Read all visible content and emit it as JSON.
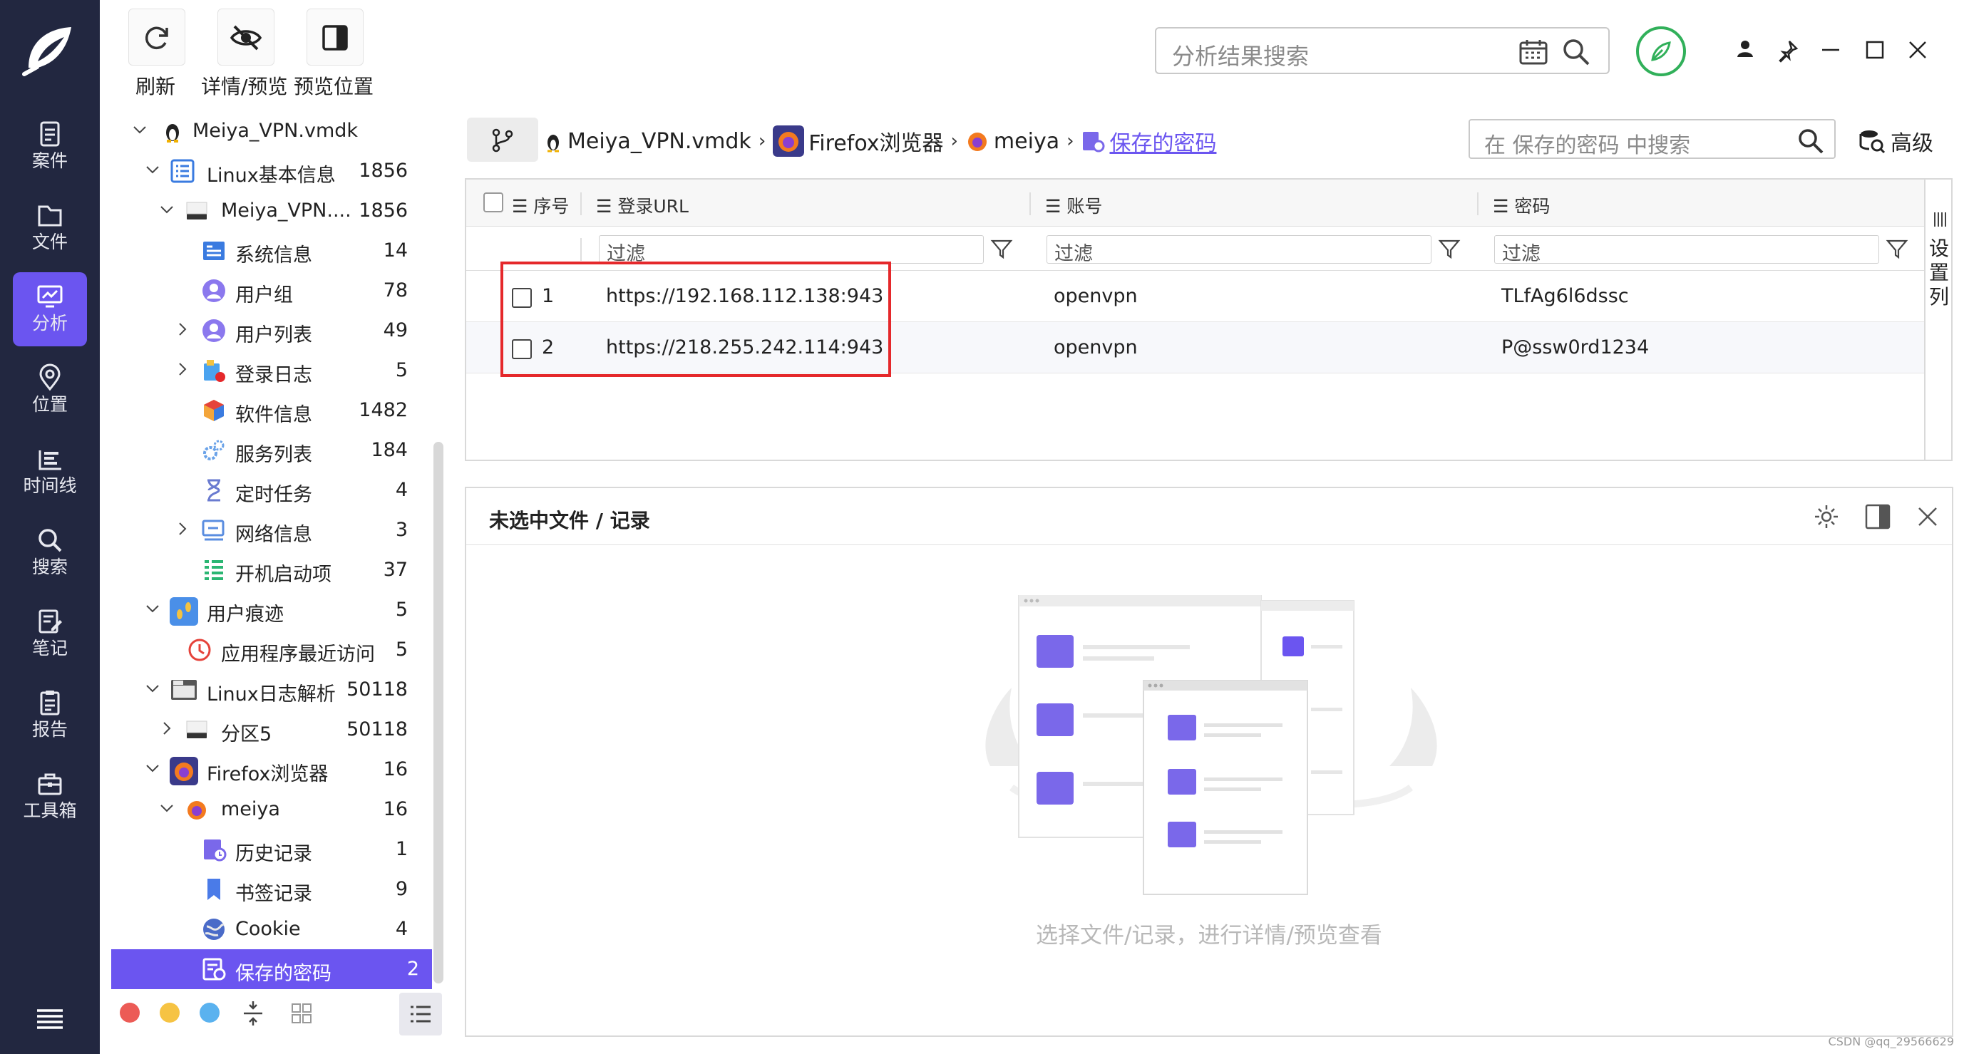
{
  "toolbar": {
    "refresh_label": "刷新",
    "detail_label": "详情/预览",
    "preview_pos_label": "预览位置",
    "search_placeholder": "分析结果搜索"
  },
  "rail": {
    "items": [
      {
        "label": "案件"
      },
      {
        "label": "文件"
      },
      {
        "label": "分析"
      },
      {
        "label": "位置"
      },
      {
        "label": "时间线"
      },
      {
        "label": "搜索"
      },
      {
        "label": "笔记"
      },
      {
        "label": "报告"
      },
      {
        "label": "工具箱"
      }
    ],
    "active_index": 2
  },
  "tree": {
    "items": [
      {
        "label": "Meiya_VPN.vmdk",
        "count": ""
      },
      {
        "label": "Linux基本信息",
        "count": "1856"
      },
      {
        "label": "Meiya_VPN....",
        "count": "1856"
      },
      {
        "label": "系统信息",
        "count": "14"
      },
      {
        "label": "用户组",
        "count": "78"
      },
      {
        "label": "用户列表",
        "count": "49"
      },
      {
        "label": "登录日志",
        "count": "5"
      },
      {
        "label": "软件信息",
        "count": "1482"
      },
      {
        "label": "服务列表",
        "count": "184"
      },
      {
        "label": "定时任务",
        "count": "4"
      },
      {
        "label": "网络信息",
        "count": "3"
      },
      {
        "label": "开机启动项",
        "count": "37"
      },
      {
        "label": "用户痕迹",
        "count": "5"
      },
      {
        "label": "应用程序最近访问",
        "count": "5"
      },
      {
        "label": "Linux日志解析",
        "count": "50118"
      },
      {
        "label": "分区5",
        "count": "50118"
      },
      {
        "label": "Firefox浏览器",
        "count": "16"
      },
      {
        "label": "meiya",
        "count": "16"
      },
      {
        "label": "历史记录",
        "count": "1"
      },
      {
        "label": "书签记录",
        "count": "9"
      },
      {
        "label": "Cookie",
        "count": "4"
      },
      {
        "label": "保存的密码",
        "count": "2"
      }
    ]
  },
  "breadcrumb": {
    "items": [
      "Meiya_VPN.vmdk",
      "Firefox浏览器",
      "meiya",
      "保存的密码"
    ],
    "search_placeholder": "在 保存的密码 中搜索",
    "advanced_label": "高级"
  },
  "grid": {
    "columns": [
      "序号",
      "登录URL",
      "账号",
      "密码"
    ],
    "filter_placeholder": "过滤",
    "rows": [
      {
        "index": "1",
        "url": "https://192.168.112.138:943",
        "account": "openvpn",
        "password": "TLfAg6l6dssc"
      },
      {
        "index": "2",
        "url": "https://218.255.242.114:943",
        "account": "openvpn",
        "password": "P@ssw0rd1234"
      }
    ],
    "set_columns_label": "设置列"
  },
  "detail": {
    "title": "未选中文件 / 记录",
    "empty_message": "选择文件/记录，进行详情/预览查看"
  },
  "watermark": "CSDN @qq_29566629",
  "colors": {
    "accent": "#6b55f0",
    "rail_bg": "#222740",
    "highlight_border": "#e5282b",
    "shield_green": "#31b05a"
  }
}
